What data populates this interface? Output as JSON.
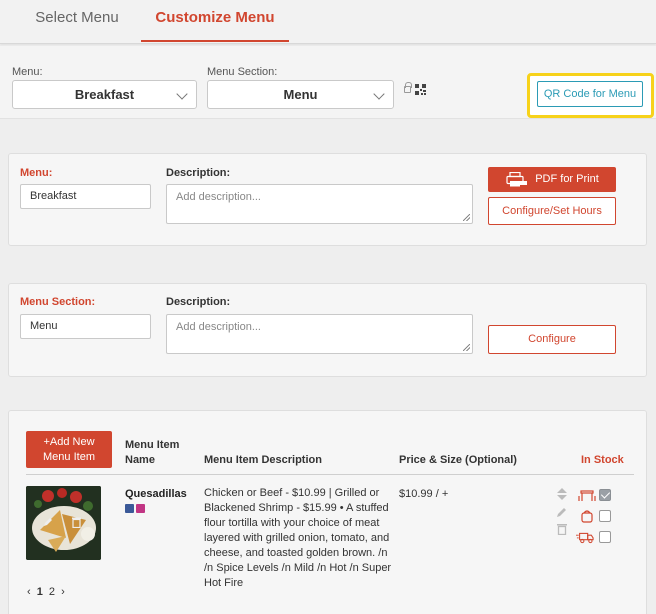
{
  "tabs": [
    {
      "label": "Select Menu"
    },
    {
      "label": "Customize Menu",
      "active": true
    }
  ],
  "selectors": {
    "menu_label": "Menu:",
    "menu_value": "Breakfast",
    "section_label": "Menu Section:",
    "section_value": "Menu",
    "qr_button": "QR Code for Menu"
  },
  "menu_panel": {
    "menu_label": "Menu:",
    "menu_value": "Breakfast",
    "description_label": "Description:",
    "description_placeholder": "Add description...",
    "pdf_button": "PDF for Print",
    "configure_hours_button": "Configure/Set Hours"
  },
  "section_panel": {
    "section_label": "Menu Section:",
    "section_value": "Menu",
    "description_label": "Description:",
    "description_placeholder": "Add description...",
    "configure_button": "Configure"
  },
  "items_table": {
    "add_button_line1": "+Add New",
    "add_button_line2": "Menu Item",
    "headers": {
      "name_line1": "Menu Item",
      "name_line2": "Name",
      "description": "Menu Item Description",
      "price": "Price & Size (Optional)",
      "in_stock": "In Stock"
    },
    "rows": [
      {
        "name": "Quesadillas",
        "description": "Chicken or Beef - $10.99 | Grilled or Blackened Shrimp - $15.99 • A stuffed flour tortilla with your choice of meat layered with grilled onion, tomato, and cheese, and toasted golden brown. /n /n Spice Levels /n Mild /n Hot /n Super Hot Fire",
        "price": "$10.99 / +",
        "stock": {
          "dine_in": true,
          "takeout": false,
          "delivery": false
        }
      }
    ]
  },
  "pagination": {
    "prev": "‹",
    "pages": [
      "1",
      "2"
    ],
    "current": "1",
    "next": "›"
  },
  "colors": {
    "accent": "#d1462f",
    "qr_button": "#2b9bb5",
    "highlight": "#f7d21a"
  }
}
